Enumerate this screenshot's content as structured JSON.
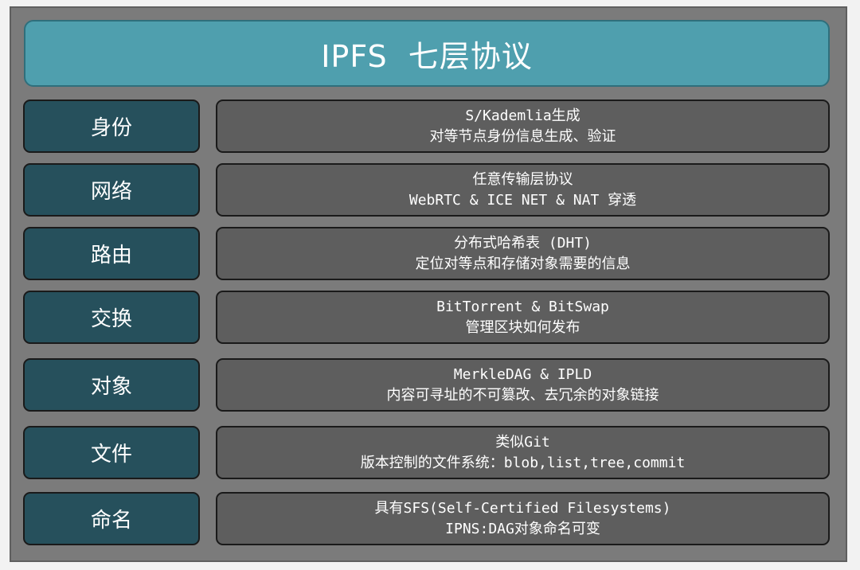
{
  "title": "IPFS  七层协议",
  "layers": [
    {
      "name": "身份",
      "line1": "S/Kademlia生成",
      "line2": "对等节点身份信息生成、验证"
    },
    {
      "name": "网络",
      "line1": "任意传输层协议",
      "line2": "WebRTC & ICE NET & NAT 穿透"
    },
    {
      "name": "路由",
      "line1": "分布式哈希表 (DHT)",
      "line2": "定位对等点和存储对象需要的信息"
    },
    {
      "name": "交换",
      "line1": "BitTorrent & BitSwap",
      "line2": "管理区块如何发布"
    },
    {
      "name": "对象",
      "line1": "MerkleDAG & IPLD",
      "line2": "内容可寻址的不可篡改、去冗余的对象链接"
    },
    {
      "name": "文件",
      "line1": "类似Git",
      "line2": "版本控制的文件系统：blob,list,tree,commit"
    },
    {
      "name": "命名",
      "line1": "具有SFS(Self-Certified Filesystems)",
      "line2": "IPNS:DAG对象命名可变"
    }
  ],
  "colors": {
    "title_bg": "#4f9fae",
    "label_bg": "#26505c",
    "desc_bg": "#5e5e5e",
    "frame_bg": "#7b7b7b"
  }
}
